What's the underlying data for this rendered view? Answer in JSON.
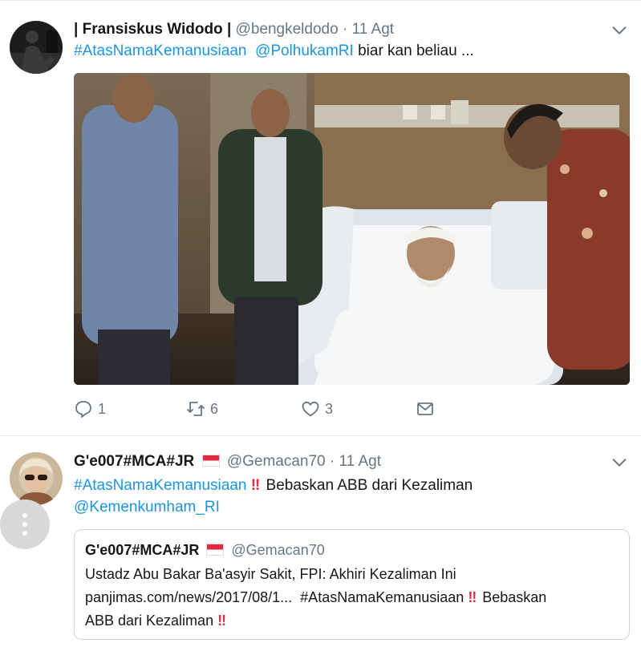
{
  "tweets": [
    {
      "name": "| Fransiskus Widodo |",
      "handle": "@bengkeldodo",
      "time": "11 Agt",
      "hashtag": "#AtasNamaKemanusiaan",
      "mention": "@PolhukamRI",
      "text": "biar kan beliau ...",
      "avatar_icon": "silhouette-avatar",
      "actions": {
        "replies": "1",
        "retweets": "6",
        "likes": "3"
      }
    },
    {
      "name": "G'e007#MCA#JR",
      "handle": "@Gemacan70",
      "time": "11 Agt",
      "hashtag": "#AtasNamaKemanusiaan",
      "bang": "‼",
      "text": "Bebaskan ABB dari Kezaliman",
      "mention": "@Kemenkumham_RI",
      "avatar_icon": "woman-with-sunglasses-avatar",
      "quote": {
        "name": "G'e007#MCA#JR",
        "handle": "@Gemacan70",
        "line1": "Ustadz Abu Bakar Ba'asyir Sakit, FPI: Akhiri Kezaliman Ini",
        "link": "panjimas.com/news/2017/08/1...",
        "hashtag": "#AtasNamaKemanusiaan",
        "bang": "‼",
        "text": "Bebaskan",
        "text2": "ABB dari Kezaliman",
        "bang2": "‼"
      }
    }
  ],
  "colors": {
    "link": "#1b95e0",
    "muted": "#657786",
    "bang": "#dd2e44",
    "border": "#e6ecf0"
  },
  "icons": {
    "reply": "reply-icon",
    "retweet": "retweet-icon",
    "like": "heart-icon",
    "dm": "envelope-icon",
    "caret": "chevron-down-icon",
    "more": "vertical-dots-icon"
  }
}
